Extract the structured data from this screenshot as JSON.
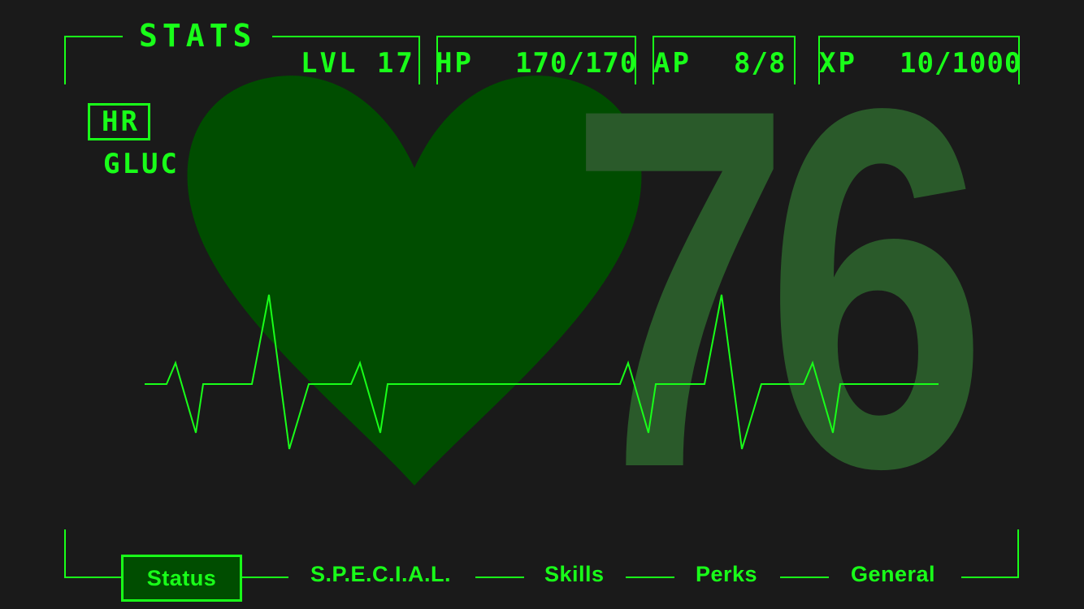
{
  "header": {
    "title": "STATS",
    "level": "LVL 17",
    "hp_label": "HP",
    "hp_value": "170/170",
    "ap_label": "AP",
    "ap_value": "8/8",
    "xp_label": "XP",
    "xp_value": "10/1000"
  },
  "sidebar": {
    "hr_label": "HR",
    "gluc_label": "GLUC"
  },
  "main": {
    "heart_rate": "76"
  },
  "tabs": [
    {
      "label": "Status",
      "active": true
    },
    {
      "label": "S.P.E.C.I.A.L.",
      "active": false
    },
    {
      "label": "Skills",
      "active": false
    },
    {
      "label": "Perks",
      "active": false
    },
    {
      "label": "General",
      "active": false
    }
  ],
  "colors": {
    "accent": "#19ff19",
    "background": "#1a1a1a",
    "heart": "#004d00",
    "number": "#2a5a2a"
  }
}
